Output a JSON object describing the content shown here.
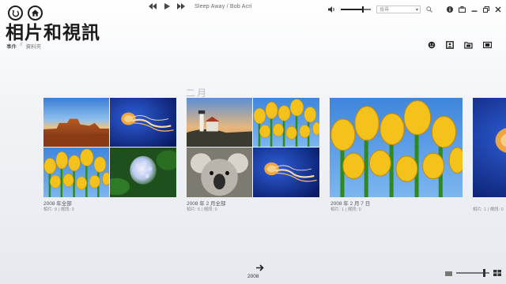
{
  "nav": {
    "back_icon": "back-arrow-icon",
    "home_icon": "home-icon"
  },
  "player": {
    "now_playing": "Sleep Away / Bob Acri",
    "prev_icon": "skip-back-icon",
    "play_icon": "play-icon",
    "next_icon": "skip-forward-icon"
  },
  "topbar": {
    "volume_level": 0.7,
    "search_placeholder": "搜尋",
    "icons": [
      "speaker-icon",
      "search-icon",
      "info-icon",
      "bag-icon",
      "minimize-icon",
      "restore-icon",
      "close-icon"
    ]
  },
  "header": {
    "title": "相片和視訊",
    "breadcrumb_active": "事件",
    "breadcrumb_sep": "//",
    "breadcrumb_other": "資料夾"
  },
  "view_modes": [
    "emoji-view-icon",
    "portrait-view-icon",
    "folder-view-icon",
    "filmstrip-view-icon"
  ],
  "month": "二月",
  "groups": [
    {
      "caption": "2008 年全部",
      "sub": "相片: 8 | 視訊: 0"
    },
    {
      "caption": "2008 年 2 月全部",
      "sub": "相片: 5 | 視訊: 0"
    },
    {
      "caption": "2008 年 2 月 7 日",
      "sub": "相片: 1 | 視訊: 0"
    },
    {
      "caption": "",
      "sub": "相片: 1 | 視訊: 0"
    }
  ],
  "footer": {
    "year": "2008",
    "zoom_level": 0.8
  }
}
